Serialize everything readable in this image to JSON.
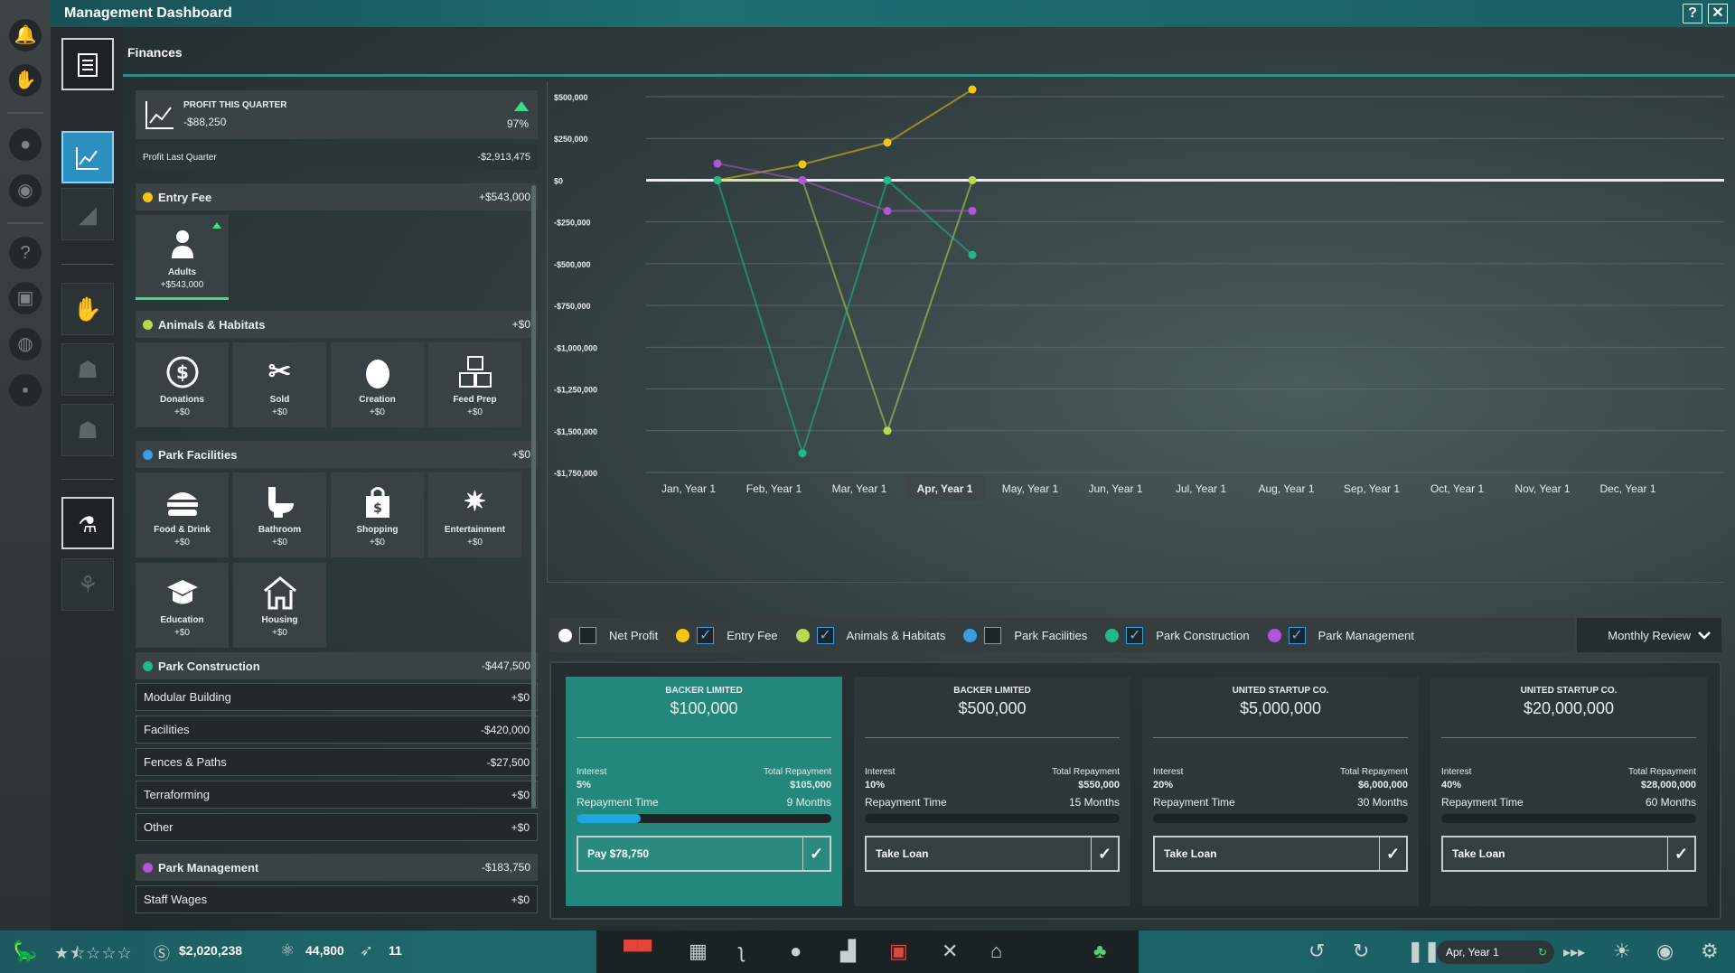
{
  "window": {
    "title": "Management Dashboard",
    "help_label": "?",
    "close_label": "✕"
  },
  "section_title": "Finances",
  "profit": {
    "label": "Profit This Quarter",
    "value": "-$88,250",
    "percent": "97%"
  },
  "last_quarter": {
    "label": "Profit Last Quarter",
    "value": "-$2,913,475"
  },
  "entry_fee": {
    "label": "Entry Fee",
    "value": "+$543,000",
    "color": "#f5c518",
    "tiles": [
      {
        "label": "Adults",
        "value": "+$543,000",
        "icon": "person-icon"
      }
    ]
  },
  "animals": {
    "label": "Animals & Habitats",
    "value": "+$0",
    "color": "#b8d850",
    "tiles": [
      {
        "label": "Donations",
        "value": "+$0",
        "icon": "dollar-circle-icon"
      },
      {
        "label": "Sold",
        "value": "+$0",
        "icon": "sold-dino-icon"
      },
      {
        "label": "Creation",
        "value": "+$0",
        "icon": "egg-icon"
      },
      {
        "label": "Feed Prep",
        "value": "+$0",
        "icon": "feed-box-icon"
      }
    ]
  },
  "facilities": {
    "label": "Park Facilities",
    "value": "+$0",
    "color": "#3a9ee3",
    "tiles": [
      {
        "label": "Food & Drink",
        "value": "+$0",
        "icon": "burger-icon"
      },
      {
        "label": "Bathroom",
        "value": "+$0",
        "icon": "toilet-icon"
      },
      {
        "label": "Shopping",
        "value": "+$0",
        "icon": "shopping-bag-icon"
      },
      {
        "label": "Entertainment",
        "value": "+$0",
        "icon": "fireworks-icon"
      },
      {
        "label": "Education",
        "value": "+$0",
        "icon": "graduation-cap-icon"
      },
      {
        "label": "Housing",
        "value": "+$0",
        "icon": "house-icon"
      }
    ]
  },
  "construction": {
    "label": "Park Construction",
    "value": "-$447,500",
    "color": "#1fb98a",
    "rows": [
      {
        "label": "Modular Building",
        "value": "+$0"
      },
      {
        "label": "Facilities",
        "value": "-$420,000"
      },
      {
        "label": "Fences & Paths",
        "value": "-$27,500"
      },
      {
        "label": "Terraforming",
        "value": "+$0"
      },
      {
        "label": "Other",
        "value": "+$0"
      }
    ]
  },
  "management": {
    "label": "Park Management",
    "value": "-$183,750",
    "color": "#b056d6",
    "rows": [
      {
        "label": "Staff Wages",
        "value": "+$0"
      }
    ]
  },
  "chart_data": {
    "type": "line",
    "x": [
      "Jan, Year 1",
      "Feb, Year 1",
      "Mar, Year 1",
      "Apr, Year 1",
      "May, Year 1",
      "Jun, Year 1",
      "Jul, Year 1",
      "Aug, Year 1",
      "Sep, Year 1",
      "Oct, Year 1",
      "Nov, Year 1",
      "Dec, Year 1"
    ],
    "selected_x": "Apr, Year 1",
    "yticks": [
      "$500,000",
      "$250,000",
      "$0",
      "-$250,000",
      "-$500,000",
      "-$750,000",
      "-$1,000,000",
      "-$1,250,000",
      "-$1,500,000",
      "-$1,750,000"
    ],
    "ylim": [
      -1750000,
      500000
    ],
    "grid": true,
    "series": [
      {
        "name": "Entry Fee",
        "color": "#f5c518",
        "values": [
          0,
          95000,
          225000,
          543000
        ]
      },
      {
        "name": "Animals & Habitats",
        "color": "#b8d850",
        "values": [
          0,
          0,
          -1500000,
          0
        ]
      },
      {
        "name": "Park Construction",
        "color": "#1fb98a",
        "values": [
          0,
          -1635000,
          0,
          -447500
        ]
      },
      {
        "name": "Park Management",
        "color": "#b056d6",
        "values": [
          100000,
          0,
          -183750,
          -183750
        ]
      }
    ]
  },
  "legend": [
    {
      "label": "Net Profit",
      "color": "#ffffff",
      "checked": false
    },
    {
      "label": "Entry Fee",
      "color": "#f5c518",
      "checked": true
    },
    {
      "label": "Animals & Habitats",
      "color": "#b8d850",
      "checked": true
    },
    {
      "label": "Park Facilities",
      "color": "#3a9ee3",
      "checked": false
    },
    {
      "label": "Park Construction",
      "color": "#1fb98a",
      "checked": true
    },
    {
      "label": "Park Management",
      "color": "#b056d6",
      "checked": true
    }
  ],
  "review_select": {
    "value": "Monthly Review"
  },
  "loans": [
    {
      "lender": "Backer Limited",
      "amount": "$100,000",
      "interest_label": "Interest",
      "interest": "5%",
      "total_label": "Total Repayment",
      "total": "$105,000",
      "time_label": "Repayment Time",
      "time": "9 Months",
      "button": "Pay $78,750",
      "progress": 0.25
    },
    {
      "lender": "Backer Limited",
      "amount": "$500,000",
      "interest_label": "Interest",
      "interest": "10%",
      "total_label": "Total Repayment",
      "total": "$550,000",
      "time_label": "Repayment Time",
      "time": "15 Months",
      "button": "Take Loan",
      "progress": 0
    },
    {
      "lender": "United Startup Co.",
      "amount": "$5,000,000",
      "interest_label": "Interest",
      "interest": "20%",
      "total_label": "Total Repayment",
      "total": "$6,000,000",
      "time_label": "Repayment Time",
      "time": "30 Months",
      "button": "Take Loan",
      "progress": 0
    },
    {
      "lender": "United Startup Co.",
      "amount": "$20,000,000",
      "interest_label": "Interest",
      "interest": "40%",
      "total_label": "Total Repayment",
      "total": "$28,000,000",
      "time_label": "Repayment Time",
      "time": "60 Months",
      "button": "Take Loan",
      "progress": 0
    }
  ],
  "statusbar": {
    "cash": "$2,020,238",
    "research": "44,800",
    "dinos": "11",
    "date": "Apr, Year 1",
    "rating_stars": 1.5
  }
}
